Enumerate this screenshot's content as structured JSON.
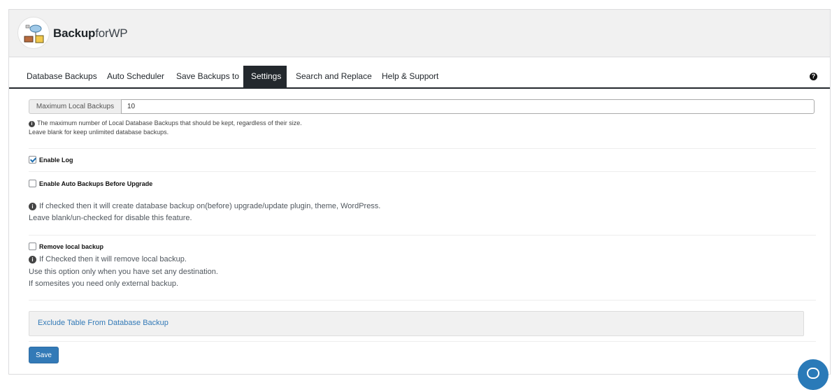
{
  "brand": {
    "name_bold": "Backup",
    "name_light": "forWP",
    "logo_icon": "cloud-server-icon"
  },
  "nav": {
    "tabs": [
      {
        "label": "Database Backups"
      },
      {
        "label": "Auto Scheduler"
      },
      {
        "label": "Save Backups to"
      },
      {
        "label": "Settings",
        "active": true
      },
      {
        "label": "Search and Replace"
      },
      {
        "label": "Help & Support"
      }
    ],
    "help_icon": "question-circle-icon"
  },
  "settings": {
    "max_local": {
      "label": "Maximum Local Backups",
      "value": "10",
      "help_line1": "The maximum number of Local Database Backups that should be kept, regardless of their size.",
      "help_line2": "Leave blank for keep unlimited database backups."
    },
    "enable_log": {
      "label": "Enable Log",
      "checked": true
    },
    "auto_backup": {
      "label": "Enable Auto Backups Before Upgrade",
      "checked": false,
      "help_line1": "If checked then it will create database backup on(before) upgrade/update plugin, theme, WordPress.",
      "help_line2": "Leave blank/un-checked for disable this feature."
    },
    "remove_local": {
      "label": "Remove local backup",
      "checked": false,
      "help_line1": "If Checked then it will remove local backup.",
      "help_line2": "Use this option only when you have set any destination.",
      "help_line3": "If somesites you need only external backup."
    },
    "exclude_table": {
      "label": "Exclude Table From Database Backup"
    },
    "save_label": "Save"
  },
  "colors": {
    "accent": "#337ab7",
    "nav_active": "#23282d",
    "chat": "#2a7ab8"
  }
}
